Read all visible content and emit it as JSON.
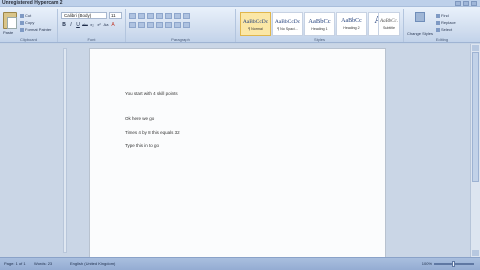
{
  "window": {
    "title": "Unregistered Hypercam 2"
  },
  "ribbon": {
    "clipboard": {
      "label": "Clipboard",
      "paste": "Paste",
      "cut": "Cut",
      "copy": "Copy",
      "format_painter": "Format Painter"
    },
    "font": {
      "label": "Font",
      "font_name": "Calibri (Body)",
      "font_size": "11",
      "buttons": [
        "B",
        "I",
        "U",
        "abc",
        "x₂",
        "x²",
        "Aa",
        "A"
      ]
    },
    "paragraph": {
      "label": "Paragraph"
    },
    "styles": {
      "label": "Styles",
      "items": [
        {
          "sample": "AaBbCcDc",
          "name": "¶ Normal"
        },
        {
          "sample": "AaBbCcDc",
          "name": "¶ No Spaci..."
        },
        {
          "sample": "AaBbCc",
          "name": "Heading 1"
        },
        {
          "sample": "AaBbCc",
          "name": "Heading 2"
        },
        {
          "sample": "AaB",
          "name": "Title"
        },
        {
          "sample": "AaBbCc.",
          "name": "Subtitle"
        }
      ],
      "change_styles": "Change Styles"
    },
    "editing": {
      "label": "Editing",
      "find": "Find",
      "replace": "Replace",
      "select": "Select"
    }
  },
  "document": {
    "lines": [
      "You start with 4 skill points",
      "Ok here we go",
      "Times 4 by 8 this equals 32",
      "Type this in to go"
    ]
  },
  "status": {
    "page": "Page: 1 of 1",
    "words": "Words: 23",
    "language": "English (United Kingdom)",
    "zoom": "100%"
  }
}
